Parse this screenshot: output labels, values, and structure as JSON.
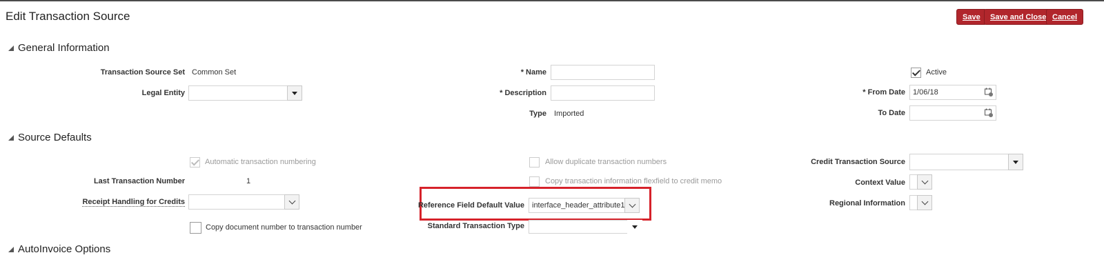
{
  "page": {
    "title": "Edit Transaction Source"
  },
  "toolbar": {
    "save": "Save",
    "save_close": "Save and Close",
    "cancel": "Cancel"
  },
  "sections": {
    "general": "General Information",
    "source_defaults": "Source Defaults",
    "autoinvoice": "AutoInvoice Options"
  },
  "general": {
    "tss_label": "Transaction Source Set",
    "tss_value": "Common Set",
    "legal_entity_label": "Legal Entity",
    "legal_entity_value": "",
    "name_label": "Name",
    "name_value": "",
    "description_label": "Description",
    "description_value": "",
    "type_label": "Type",
    "type_value": "Imported",
    "active_label": "Active",
    "active_checked": true,
    "from_date_label": "From Date",
    "from_date_value": "1/06/18",
    "to_date_label": "To Date",
    "to_date_value": "",
    "required_marker": "*"
  },
  "source_defaults": {
    "auto_numbering_label": "Automatic transaction numbering",
    "auto_numbering_checked": true,
    "allow_dup_label": "Allow duplicate transaction numbers",
    "copy_flex_label": "Copy transaction information flexfield to credit memo",
    "last_txn_label": "Last Transaction Number",
    "last_txn_value": "1",
    "receipt_handling_label": "Receipt Handling for Credits",
    "receipt_handling_value": "",
    "copy_doc_label": "Copy document number to transaction number",
    "ref_field_label": "Reference Field Default Value",
    "ref_field_value": "interface_header_attribute1",
    "std_txn_type_label": "Standard Transaction Type",
    "std_txn_type_value": "",
    "credit_source_label": "Credit Transaction Source",
    "credit_source_value": "",
    "context_value_label": "Context Value",
    "regional_info_label": "Regional Information"
  },
  "colors": {
    "accent": "#b1262c",
    "highlight": "#d6222a"
  }
}
